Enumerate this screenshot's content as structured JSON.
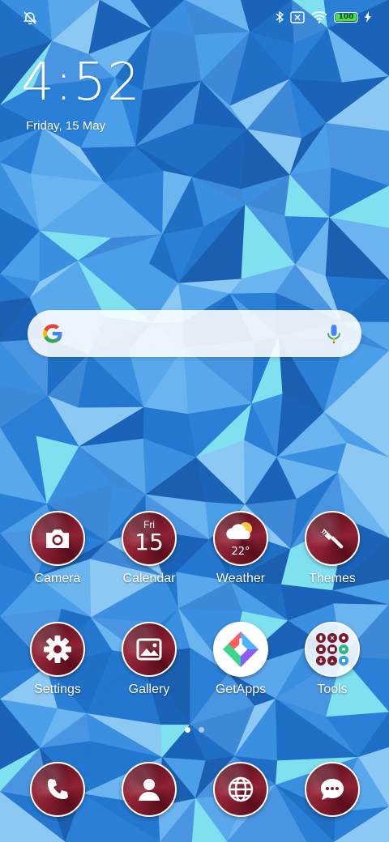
{
  "status_bar": {
    "icons": [
      "alarm-off-icon",
      "bluetooth-icon",
      "sim-off-icon",
      "wifi-icon",
      "charging-icon"
    ],
    "battery_level": 100,
    "battery_label": "100",
    "battery_color": "#4cdc4c"
  },
  "lockscreen": {
    "time": "4:52",
    "date": "Friday, 15 May"
  },
  "search": {
    "icons": [
      "google-logo-icon",
      "microphone-icon"
    ]
  },
  "apps": {
    "row1": [
      {
        "label": "Camera",
        "icon": "camera-icon"
      },
      {
        "label": "Calendar",
        "icon": "calendar-icon",
        "day": "Fri",
        "date_num": "15"
      },
      {
        "label": "Weather",
        "icon": "weather-icon",
        "temp": "22°"
      },
      {
        "label": "Themes",
        "icon": "paintbrush-icon"
      }
    ],
    "row2": [
      {
        "label": "Settings",
        "icon": "gear-icon"
      },
      {
        "label": "Gallery",
        "icon": "gallery-icon"
      },
      {
        "label": "GetApps",
        "icon": "getapps-icon"
      },
      {
        "label": "Tools",
        "icon": "tools-folder-icon"
      }
    ]
  },
  "page_indicator": {
    "pages": 2,
    "current": 1
  },
  "dock": [
    {
      "icon": "phone-icon"
    },
    {
      "icon": "contacts-icon"
    },
    {
      "icon": "browser-icon"
    },
    {
      "icon": "messages-icon"
    }
  ],
  "colors": {
    "icon_background": "#6d1424",
    "wallpaper_base": "#2f7fd4"
  }
}
